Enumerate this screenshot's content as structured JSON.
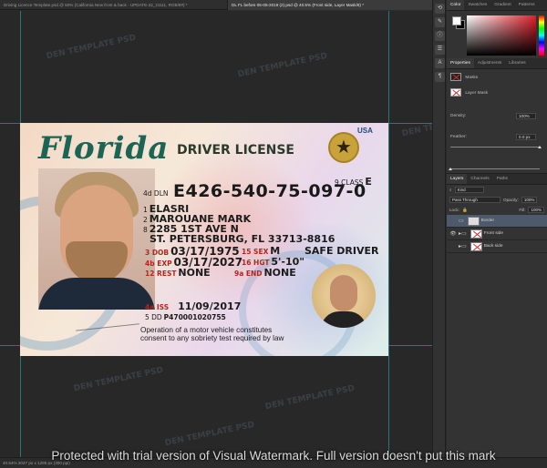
{
  "tabs": [
    {
      "label": "Driving Licence Template.psd @ 50% (California New front & back - UPDATE-22_21111, RGB/8#) *"
    },
    {
      "label": "DL FL before 05-05-2019 (2).psd @ 40.5% (Front side, Layer Mask/8) *"
    }
  ],
  "watermark_text": "DEN TEMPLATE PSD",
  "license": {
    "state": "Florida",
    "title": "DRIVER LICENSE",
    "country": "USA",
    "class_label": "9 CLASS",
    "class_value": "E",
    "dln_label": "4d DLN",
    "dln": "E426-540-75-097-0",
    "name_num": "1",
    "last_name": "ELASRI",
    "name_num2": "2",
    "first_name": "MAROUANE MARK",
    "addr_num": "8",
    "address1": "2285 1ST AVE N",
    "address2": "ST. PETERSBURG, FL 33713-8816",
    "dob_label": "3  DOB",
    "dob": "03/17/1975",
    "sex_label": "15 SEX",
    "sex": "M",
    "safe_driver": "SAFE DRIVER",
    "exp_label": "4b EXP",
    "exp": "03/17/2027",
    "hgt_label": "16 HGT",
    "hgt": "5'-10\"",
    "rest_label": "12 REST",
    "rest": "NONE",
    "end_label": "9a END",
    "end": "NONE",
    "iss_label": "4a ISS",
    "iss": "11/09/2017",
    "dd_label": "5 DD",
    "dd": "P470001020755",
    "donor_line1": "Operation of a motor vehicle constitutes",
    "donor_line2": "consent to any sobriety test required by law"
  },
  "panels": {
    "color_tabs": [
      "Color",
      "Swatches",
      "Gradient",
      "Patterns"
    ],
    "fg_color": "#ffffff",
    "bg_color": "#000000",
    "props_tabs": [
      "Properties",
      "Adjustments",
      "Libraries"
    ],
    "masks_label": "Masks",
    "layer_mask_label": "Layer Mask",
    "density_label": "Density:",
    "density_value": "100%",
    "feather_label": "Feather:",
    "feather_value": "0.0 px",
    "layers_tabs": [
      "Layers",
      "Channels",
      "Paths"
    ],
    "kind_label": "Kind",
    "blend_mode": "Pass Through",
    "opacity_label": "Opacity:",
    "opacity_value": "100%",
    "lock_label": "Lock:",
    "fill_label": "Fill:",
    "fill_value": "100%",
    "layers": [
      {
        "name": "Border"
      },
      {
        "name": "Front side"
      },
      {
        "name": "Back side"
      }
    ]
  },
  "status_text": "40.54%   2047 px x 1295 px (300 ppi)",
  "notice": "Protected with trial version of Visual Watermark. Full version doesn't put this mark"
}
